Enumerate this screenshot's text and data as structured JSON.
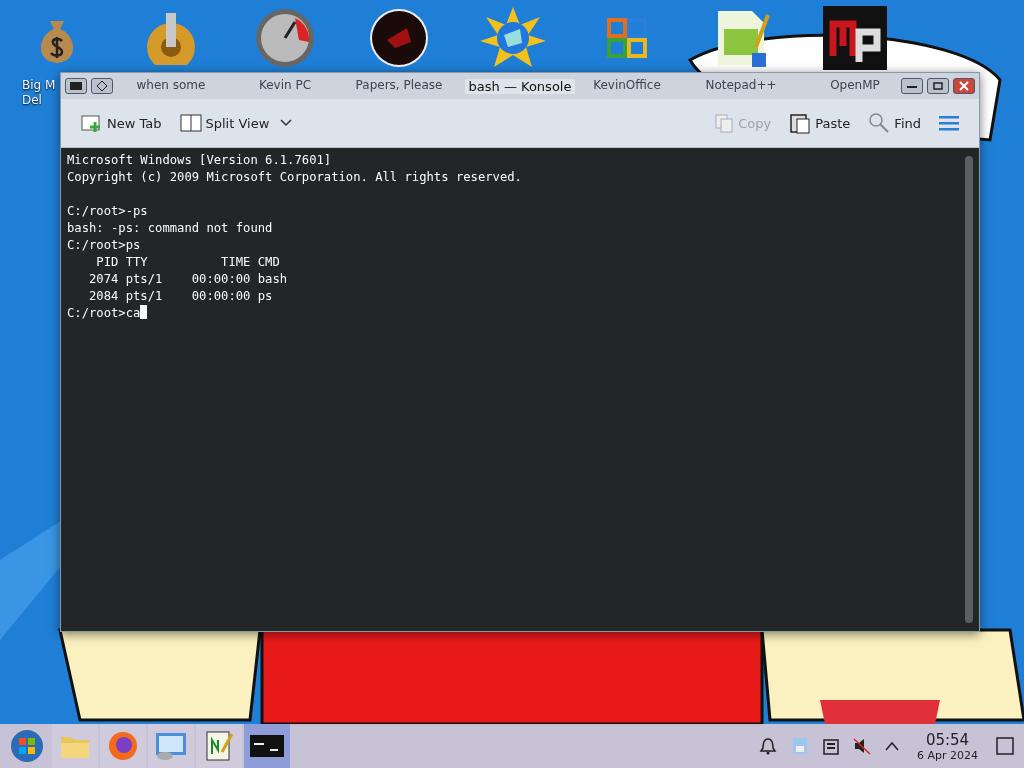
{
  "desktop_icons": [
    {
      "label": "Big M",
      "label_line2": "Del",
      "kind": "money"
    },
    {
      "label": "when some",
      "kind": "gear"
    },
    {
      "label": "Kevin PC",
      "kind": "gauge"
    },
    {
      "label": "Papers, Please",
      "kind": "disc"
    },
    {
      "kind": "globe"
    },
    {
      "label": "KevinOffice",
      "kind": "office"
    },
    {
      "label": "Notepad++",
      "kind": "notepad"
    },
    {
      "label": "OpenMP",
      "kind": "mp"
    }
  ],
  "window": {
    "title": "bash — Konsole"
  },
  "toolbar": [
    {
      "label": "New Tab",
      "kind": "newtab",
      "disabled": false
    },
    {
      "label": "Split View",
      "kind": "split",
      "disabled": false
    },
    {
      "label": "Copy",
      "kind": "copy",
      "disabled": true
    },
    {
      "label": "Paste",
      "kind": "paste",
      "disabled": false
    },
    {
      "label": "Find",
      "kind": "find",
      "disabled": false
    }
  ],
  "terminal": {
    "blocks": [
      [
        "Microsoft Windows [Version 6.1.7601]",
        "Copyright (c) 2009 Microsoft Corporation. All rights reserved."
      ],
      [
        "C:/root>-ps",
        "bash: -ps: command not found",
        "C:/root>ps",
        "    PID TTY          TIME CMD",
        "   2074 pts/1    00:00:00 bash",
        "   2084 pts/1    00:00:00 ps"
      ]
    ],
    "prompt": "C:/root>ca"
  },
  "taskbar": {
    "apps": [
      {
        "kind": "folder",
        "selected": false
      },
      {
        "kind": "firefox",
        "selected": false
      },
      {
        "kind": "settings",
        "selected": false
      },
      {
        "kind": "notepad",
        "selected": false
      },
      {
        "kind": "terminal",
        "selected": true
      }
    ],
    "tray": [
      {
        "kind": "bell"
      },
      {
        "kind": "updates"
      },
      {
        "kind": "clipboard"
      },
      {
        "kind": "muted"
      },
      {
        "kind": "expand"
      }
    ],
    "time": "05:54",
    "date": "6 Apr 2024"
  }
}
